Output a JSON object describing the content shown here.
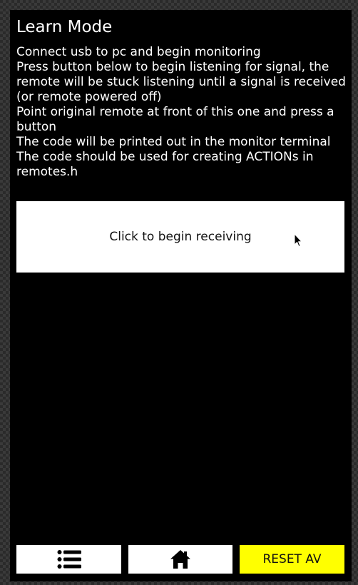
{
  "page": {
    "title": "Learn Mode",
    "instructions": [
      "Connect usb to pc and begin monitoring",
      "Press button below to begin listening for signal, the remote will be stuck listening until a signal is received (or remote powered off)",
      "Point original remote at front of this one and press a button",
      "The code will be printed out in the monitor terminal",
      "The code should be used for creating ACTIONs in remotes.h"
    ],
    "receive_button_label": "Click to begin receiving"
  },
  "bottom_bar": {
    "menu_icon": "list-icon",
    "home_icon": "home-icon",
    "reset_label": "RESET AV"
  },
  "colors": {
    "screen_background": "#000000",
    "button_background": "#ffffff",
    "reset_accent": "#ffff00"
  }
}
